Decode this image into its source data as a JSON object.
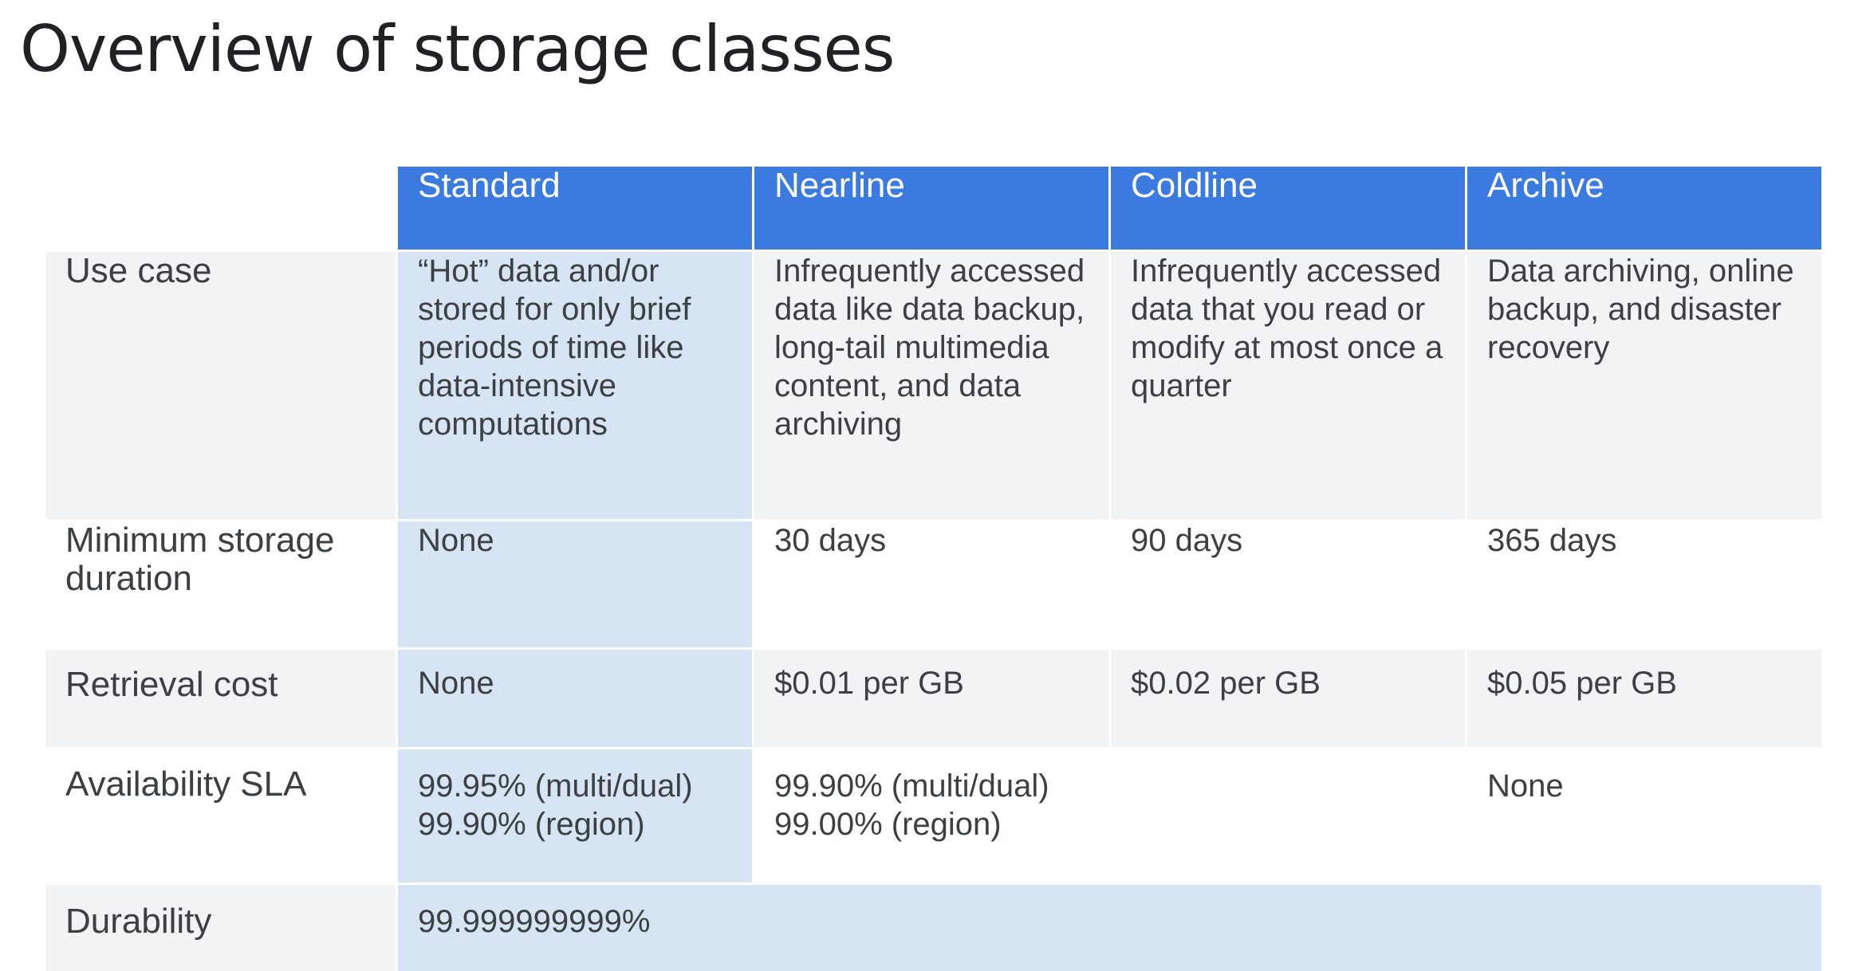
{
  "title": "Overview of storage classes",
  "table": {
    "columns": [
      "Standard",
      "Nearline",
      "Coldline",
      "Archive"
    ],
    "rows": {
      "use_case": {
        "label": "Use case",
        "standard": "“Hot” data and/or stored for only brief periods of time like data-intensive computations",
        "nearline": "Infrequently accessed data like data backup, long-tail multimedia content, and data archiving",
        "coldline": "Infrequently accessed data that you read or modify at most once a quarter",
        "archive": "Data archiving, online backup, and disaster recovery"
      },
      "min_duration": {
        "label": "Minimum storage duration",
        "standard": "None",
        "nearline": "30 days",
        "coldline": "90 days",
        "archive": "365 days"
      },
      "retrieval_cost": {
        "label": "Retrieval cost",
        "standard": "None",
        "nearline": "$0.01 per GB",
        "coldline": "$0.02 per GB",
        "archive": "$0.05 per GB"
      },
      "availability_sla": {
        "label": "Availability SLA",
        "standard_line1": "99.95% (multi/dual)",
        "standard_line2": "99.90% (region)",
        "nearline_coldline_line1": "99.90% (multi/dual)",
        "nearline_coldline_line2": "99.00% (region)",
        "archive": "None"
      },
      "durability": {
        "label": "Durability",
        "all": "99.999999999%"
      }
    }
  },
  "colors": {
    "header_blue": "#3b7be0",
    "standard_column_blue": "#d6e4f4",
    "row_grey": "#f1f3f4",
    "text": "#3c4043"
  }
}
